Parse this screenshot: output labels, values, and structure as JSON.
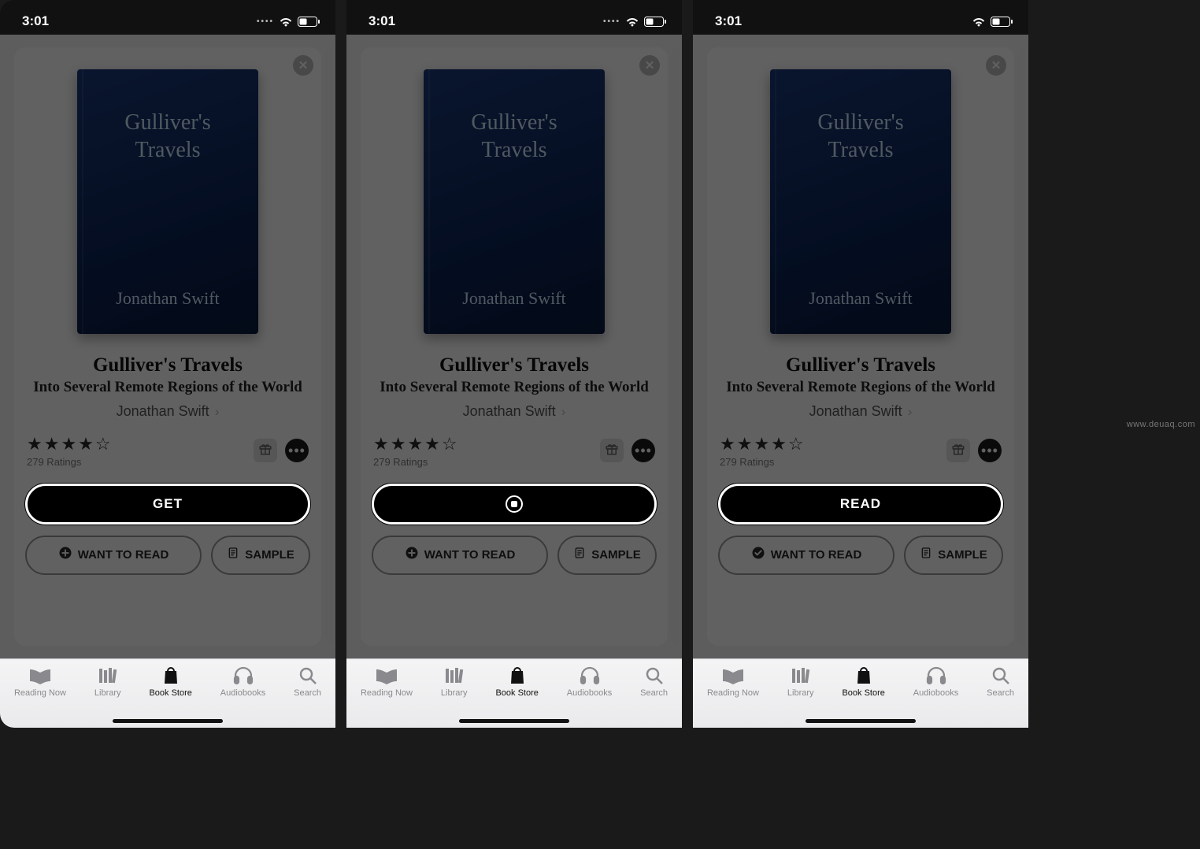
{
  "watermark": "www.deuaq.com",
  "status": {
    "time": "3:01"
  },
  "book": {
    "cover_title_line1": "Gulliver's",
    "cover_title_line2": "Travels",
    "cover_author": "Jonathan Swift",
    "title": "Gulliver's Travels",
    "subtitle": "Into Several Remote Regions of the World",
    "author": "Jonathan Swift",
    "ratings_count": "279 Ratings",
    "stars_display": "★★★★☆"
  },
  "buttons": {
    "want_to_read": "WANT TO READ",
    "sample": "SAMPLE"
  },
  "primary_labels": {
    "get": "GET",
    "read": "READ"
  },
  "tabs": {
    "reading_now": "Reading Now",
    "library": "Library",
    "book_store": "Book Store",
    "audiobooks": "Audiobooks",
    "search": "Search"
  },
  "screens": [
    {
      "primary_mode": "get",
      "want_icon": "plus"
    },
    {
      "primary_mode": "spin",
      "want_icon": "plus"
    },
    {
      "primary_mode": "read",
      "want_icon": "check"
    }
  ]
}
